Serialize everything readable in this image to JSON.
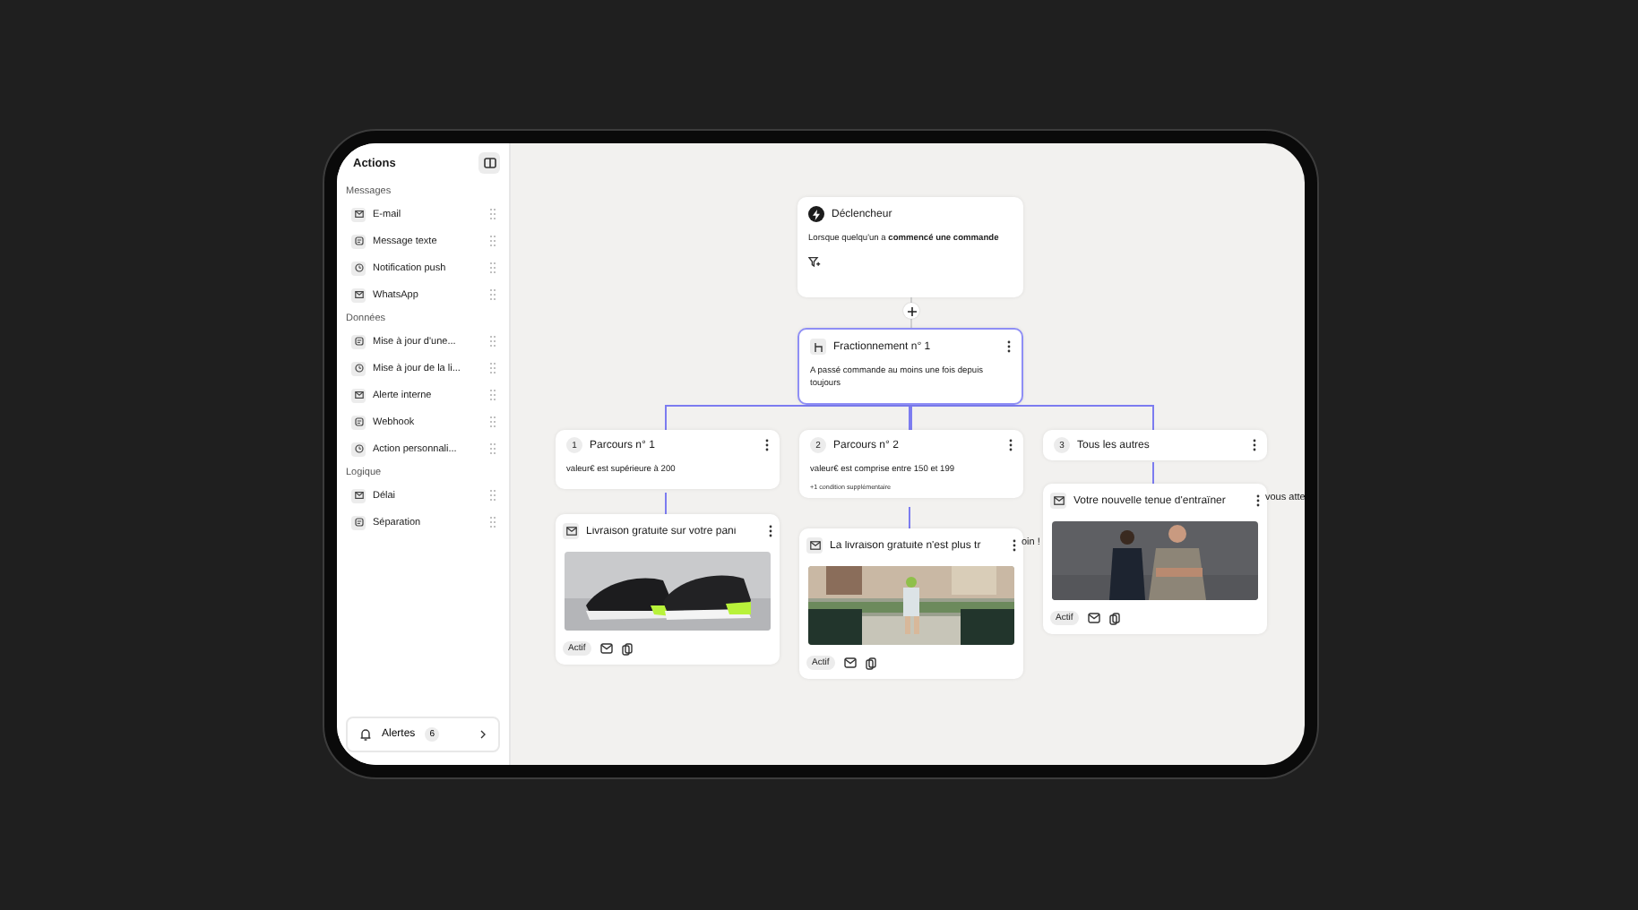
{
  "sidebar": {
    "title": "Actions",
    "sections": [
      {
        "label": "Messages",
        "items": [
          {
            "label": "E-mail"
          },
          {
            "label": "Message texte"
          },
          {
            "label": "Notification push"
          },
          {
            "label": "WhatsApp"
          }
        ]
      },
      {
        "label": "Données",
        "items": [
          {
            "label": "Mise à jour d'une..."
          },
          {
            "label": "Mise à jour de la li..."
          },
          {
            "label": "Alerte interne"
          },
          {
            "label": "Webhook"
          },
          {
            "label": "Action personnali..."
          }
        ]
      },
      {
        "label": "Logique",
        "items": [
          {
            "label": "Délai"
          },
          {
            "label": "Séparation"
          }
        ]
      }
    ],
    "alerts": {
      "label": "Alertes",
      "count": "6"
    }
  },
  "trigger": {
    "title": "Déclencheur",
    "text": "Lorsque quelqu'un a **commencé une commande**"
  },
  "split": {
    "title": "Fractionnement n° 1",
    "text": "A passé commande au moins une fois depuis toujours"
  },
  "branches": [
    {
      "number": "1",
      "title": "Parcours n° 1",
      "condition": "valeur€ est supérieure à 200",
      "message": {
        "title": "Livraison gratuite sur votre pani",
        "status": "Actif",
        "kind": "picture"
      }
    },
    {
      "number": "2",
      "title": "Parcours n° 2",
      "condition": "valeur€ est comprise entre 150 et 199",
      "extra": "+1 condition supplémentaire",
      "message": {
        "title": "La livraison gratuite n'est plus tr",
        "tail": "oin !",
        "status": "Actif",
        "kind": "picture"
      }
    },
    {
      "number": "3",
      "title": "Tous les autres",
      "message": {
        "title": "Votre nouvelle tenue d'entraîner",
        "tail": "vous atte",
        "status": "Actif",
        "kind": "picture"
      }
    }
  ]
}
